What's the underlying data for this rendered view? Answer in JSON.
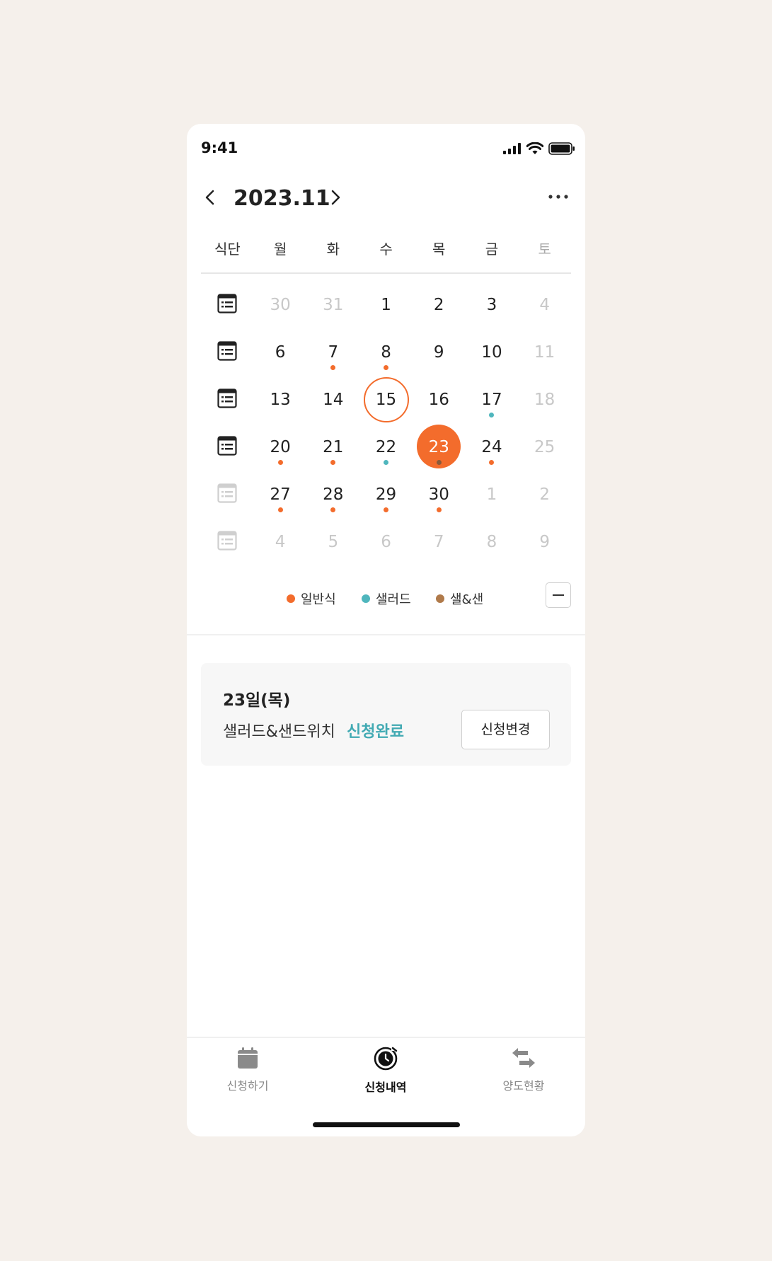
{
  "status_bar": {
    "time": "9:41"
  },
  "header": {
    "month_title": "2023.11"
  },
  "weekdays": [
    "식단",
    "월",
    "화",
    "수",
    "목",
    "금",
    "토"
  ],
  "weeks": [
    {
      "menu_enabled": true,
      "days": [
        {
          "n": "30",
          "muted": true
        },
        {
          "n": "31",
          "muted": true
        },
        {
          "n": "1"
        },
        {
          "n": "2"
        },
        {
          "n": "3"
        },
        {
          "n": "4",
          "muted": true
        }
      ]
    },
    {
      "menu_enabled": true,
      "days": [
        {
          "n": "6"
        },
        {
          "n": "7",
          "dot": "orange"
        },
        {
          "n": "8",
          "dot": "orange"
        },
        {
          "n": "9"
        },
        {
          "n": "10"
        },
        {
          "n": "11",
          "muted": true
        }
      ]
    },
    {
      "menu_enabled": true,
      "days": [
        {
          "n": "13"
        },
        {
          "n": "14"
        },
        {
          "n": "15",
          "today": true
        },
        {
          "n": "16"
        },
        {
          "n": "17",
          "dot": "teal"
        },
        {
          "n": "18",
          "muted": true
        }
      ]
    },
    {
      "menu_enabled": true,
      "days": [
        {
          "n": "20",
          "dot": "orange"
        },
        {
          "n": "21",
          "dot": "orange"
        },
        {
          "n": "22",
          "dot": "teal"
        },
        {
          "n": "23",
          "selected": true,
          "dot": "brown"
        },
        {
          "n": "24",
          "dot": "orange"
        },
        {
          "n": "25",
          "muted": true
        }
      ]
    },
    {
      "menu_enabled": false,
      "days": [
        {
          "n": "27",
          "dot": "orange"
        },
        {
          "n": "28",
          "dot": "orange"
        },
        {
          "n": "29",
          "dot": "orange"
        },
        {
          "n": "30",
          "dot": "orange"
        },
        {
          "n": "1",
          "muted": true
        },
        {
          "n": "2",
          "muted": true
        }
      ]
    },
    {
      "menu_enabled": false,
      "days": [
        {
          "n": "4",
          "muted": true
        },
        {
          "n": "5",
          "muted": true
        },
        {
          "n": "6",
          "muted": true
        },
        {
          "n": "7",
          "muted": true
        },
        {
          "n": "8",
          "muted": true
        },
        {
          "n": "9",
          "muted": true
        }
      ]
    }
  ],
  "legend": [
    {
      "label": "일반식",
      "color": "#f36c2c"
    },
    {
      "label": "샐러드",
      "color": "#4fb6bd"
    },
    {
      "label": "샐&샌",
      "color": "#b07a4a"
    }
  ],
  "dot_colors": {
    "orange": "#f36c2c",
    "teal": "#4fb6bd",
    "brown": "#8a5a3a"
  },
  "card": {
    "date": "23일(목)",
    "menu": "샐러드&샌드위치",
    "status": "신청완료",
    "button": "신청변경"
  },
  "tabs": [
    {
      "label": "신청하기",
      "icon": "calendar-icon",
      "active": false
    },
    {
      "label": "신청내역",
      "icon": "history-clock-icon",
      "active": true
    },
    {
      "label": "양도현황",
      "icon": "transfer-arrows-icon",
      "active": false
    }
  ]
}
